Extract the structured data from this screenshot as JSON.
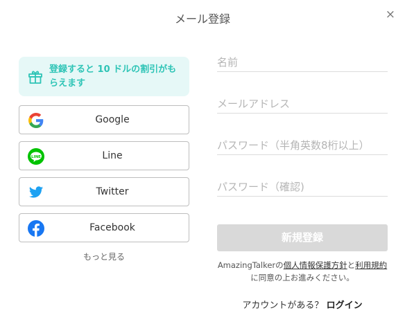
{
  "dialog": {
    "title": "メール登録",
    "close_glyph": "×"
  },
  "promo": {
    "icon": "gift-icon",
    "text": "登録すると 10 ドルの割引がもらえます",
    "color": "#2ec4b6",
    "background": "#e6f8f7"
  },
  "social": [
    {
      "label": "Google",
      "icon": "google-icon"
    },
    {
      "label": "Line",
      "icon": "line-icon"
    },
    {
      "label": "Twitter",
      "icon": "twitter-icon"
    },
    {
      "label": "Facebook",
      "icon": "facebook-icon"
    }
  ],
  "more_label": "もっと見る",
  "form": {
    "name_placeholder": "名前",
    "email_placeholder": "メールアドレス",
    "password_placeholder": "パスワード（半角英数8桁以上）",
    "confirm_placeholder": "パスワード（確認)",
    "submit_label": "新規登録"
  },
  "terms": {
    "prefix": "AmazingTalkerの",
    "privacy_link": "個人情報保護方針",
    "and": "と",
    "terms_link": "利用規約",
    "suffix": "に同意の上お進みください。"
  },
  "login": {
    "prompt": "アカウントがある？",
    "link": "ログイン"
  }
}
